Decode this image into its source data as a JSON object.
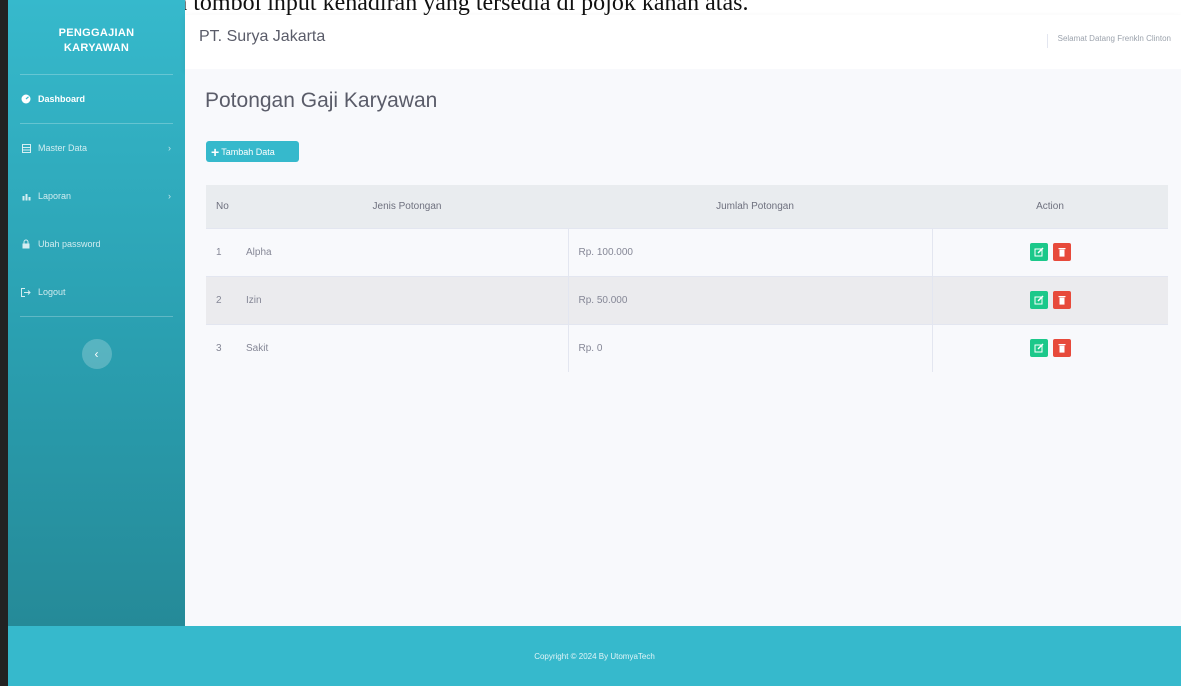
{
  "caption": {
    "text": "at dengan menekan tombol input kehadiran yang tersedia di pojok kanan atas."
  },
  "sidebar": {
    "brand_line1": "PENGGAJIAN",
    "brand_line2": "KARYAWAN",
    "items": [
      {
        "label": "Dashboard",
        "icon": "dashboard-icon",
        "active": true
      },
      {
        "label": "Master Data",
        "icon": "table-icon",
        "has_submenu": true
      },
      {
        "label": "Laporan",
        "icon": "report-icon",
        "has_submenu": true
      },
      {
        "label": "Ubah password",
        "icon": "lock-icon"
      },
      {
        "label": "Logout",
        "icon": "logout-icon"
      }
    ],
    "toggle_icon": "chevron-left-icon"
  },
  "topbar": {
    "company": "PT. Surya Jakarta",
    "welcome": "Selamat Datang Frenkln Clinton"
  },
  "main": {
    "title": "Potongan Gaji Karyawan",
    "add_button": "Tambah Data",
    "table": {
      "headers": [
        "No",
        "Jenis Potongan",
        "Jumlah Potongan",
        "Action"
      ],
      "rows": [
        {
          "no": "1",
          "jenis": "Alpha",
          "jumlah": "Rp. 100.000"
        },
        {
          "no": "2",
          "jenis": "Izin",
          "jumlah": "Rp. 50.000"
        },
        {
          "no": "3",
          "jenis": "Sakit",
          "jumlah": "Rp. 0"
        }
      ]
    }
  },
  "footer": {
    "text": "Copyright © 2024 By UtomyaTech"
  },
  "colors": {
    "primary": "#36b9cc",
    "edit": "#1cc88a",
    "delete": "#e74a3b"
  }
}
